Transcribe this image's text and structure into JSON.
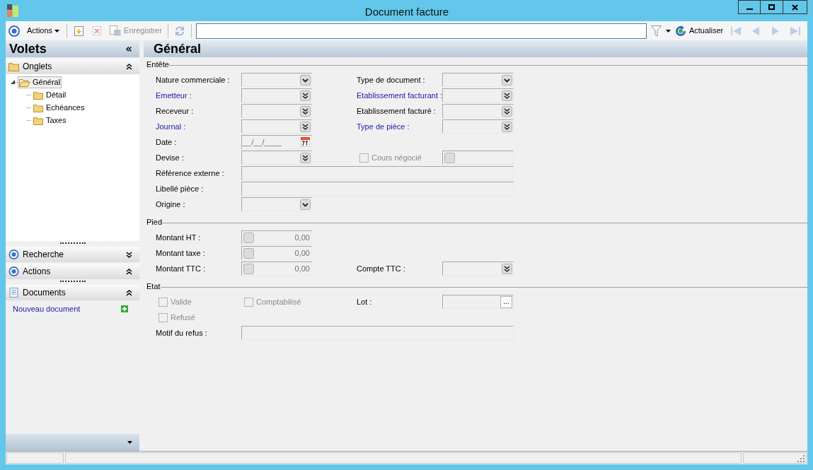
{
  "window": {
    "title": "Document facture"
  },
  "toolbar": {
    "actions_menu": "Actions",
    "new_disabled": false,
    "delete_disabled": true,
    "save": {
      "label": "Enregistrer",
      "disabled": true
    },
    "sync_disabled": true,
    "refresh": "Actualiser",
    "nav_disabled": true
  },
  "left_pane": {
    "title": "Volets",
    "sections": [
      {
        "kind": "folder",
        "title": "Onglets",
        "expanded": true,
        "tree": [
          {
            "label": "Général",
            "selected": true,
            "expanded": true,
            "children": [
              {
                "label": "Détail",
                "selected": false
              },
              {
                "label": "Echéances",
                "selected": false
              },
              {
                "label": "Taxes",
                "selected": false
              }
            ]
          }
        ]
      },
      {
        "kind": "target",
        "title": "Recherche",
        "expanded": false
      },
      {
        "kind": "target",
        "title": "Actions",
        "expanded": true
      },
      {
        "kind": "document",
        "title": "Documents",
        "expanded": true,
        "links": [
          "Nouveau document"
        ]
      }
    ]
  },
  "main": {
    "title": "Général",
    "sections": [
      {
        "title": "Entête",
        "rows": [
          {
            "left": [
              {
                "kind": "label",
                "text": "Nature commerciale :",
                "required": false
              },
              {
                "kind": "combo"
              }
            ],
            "right": [
              {
                "kind": "label",
                "text": "Type de document :",
                "required": false
              },
              {
                "kind": "combo"
              }
            ]
          },
          {
            "left": [
              {
                "kind": "label",
                "text": "Emetteur :",
                "required": true
              },
              {
                "kind": "lookup"
              }
            ],
            "right": [
              {
                "kind": "label",
                "text": "Etablissement facturant :",
                "required": true
              },
              {
                "kind": "lookup"
              }
            ]
          },
          {
            "left": [
              {
                "kind": "label",
                "text": "Receveur :",
                "required": false
              },
              {
                "kind": "lookup"
              }
            ],
            "right": [
              {
                "kind": "label",
                "text": "Etablissement facturé :",
                "required": false
              },
              {
                "kind": "lookup"
              }
            ]
          },
          {
            "left": [
              {
                "kind": "label",
                "text": "Journal :",
                "required": true
              },
              {
                "kind": "lookup"
              }
            ],
            "right": [
              {
                "kind": "label",
                "text": "Type de pièce :",
                "required": true
              },
              {
                "kind": "lookup"
              }
            ]
          },
          {
            "left": [
              {
                "kind": "label",
                "text": "Date :",
                "required": false
              },
              {
                "kind": "date",
                "value": "__/__/____"
              }
            ]
          },
          {
            "left": [
              {
                "kind": "label",
                "text": "Devise :",
                "required": false
              },
              {
                "kind": "lookup"
              }
            ],
            "right": [
              {
                "kind": "checkbox",
                "text": "Cours négocié",
                "checked": false,
                "disabled": true
              },
              {
                "kind": "amount"
              }
            ]
          },
          {
            "left": [
              {
                "kind": "label",
                "text": "Référence externe :",
                "required": false
              },
              {
                "kind": "text"
              }
            ]
          },
          {
            "left": [
              {
                "kind": "label",
                "text": "Libellé pièce :",
                "required": false
              },
              {
                "kind": "text"
              }
            ]
          },
          {
            "left": [
              {
                "kind": "label",
                "text": "Origine :",
                "required": false
              },
              {
                "kind": "combo"
              }
            ]
          }
        ]
      },
      {
        "title": "Pied",
        "rows": [
          {
            "left": [
              {
                "kind": "label",
                "text": "Montant HT :",
                "required": false
              },
              {
                "kind": "amount",
                "value": "0,00"
              }
            ]
          },
          {
            "left": [
              {
                "kind": "label",
                "text": "Montant taxe :",
                "required": false
              },
              {
                "kind": "amount",
                "value": "0,00"
              }
            ]
          },
          {
            "left": [
              {
                "kind": "label",
                "text": "Montant TTC :",
                "required": false
              },
              {
                "kind": "amount",
                "value": "0,00"
              }
            ],
            "right": [
              {
                "kind": "label",
                "text": "Compte TTC :",
                "required": false
              },
              {
                "kind": "lookup"
              }
            ]
          }
        ]
      },
      {
        "title": "Etat",
        "rows": [
          {
            "left": [
              {
                "kind": "checkbox",
                "text": "Valide",
                "checked": false,
                "disabled": true
              },
              {
                "kind": "checkbox",
                "text": "Comptabilisé",
                "checked": false,
                "disabled": true
              }
            ],
            "right": [
              {
                "kind": "label",
                "text": "Lot :",
                "required": false
              },
              {
                "kind": "picker",
                "button": "..."
              }
            ]
          },
          {
            "left": [
              {
                "kind": "checkbox",
                "text": "Refusé",
                "checked": false,
                "disabled": true
              }
            ]
          },
          {
            "left": [
              {
                "kind": "label",
                "text": "Motif du refus :",
                "required": false
              },
              {
                "kind": "text"
              }
            ]
          }
        ]
      }
    ]
  }
}
